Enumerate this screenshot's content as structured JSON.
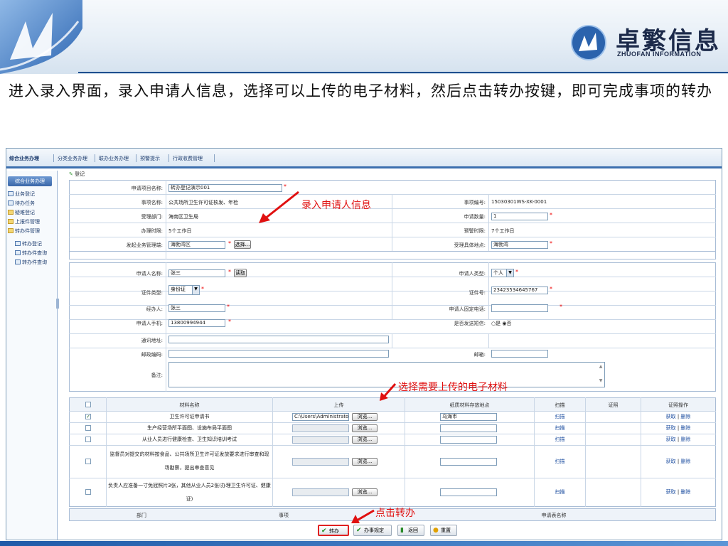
{
  "brand": {
    "name_cn": "卓繁信息",
    "name_en": "ZHUOFAN INFORMATION"
  },
  "instruction": "进入录入界面，录入申请人信息，选择可以上传的电子材料，然后点击转办按键，即可完成事项的转办",
  "app": {
    "nav_tabs": [
      "综合业务办理",
      "分类业务办理",
      "联办业务办理",
      "预警提示",
      "行政收费管理"
    ],
    "sidebar": {
      "title": "综合业务办理",
      "items": [
        "业务登记",
        "待办任务",
        "疑难登记",
        "上报件管理",
        "转办件管理",
        "转办登记",
        "转办件查询",
        "转办件查询"
      ]
    },
    "form_caption": "登记",
    "form": {
      "item_name": {
        "label": "申请项目名称:",
        "value": "转办登记演示001"
      },
      "matter": {
        "label": "事项名称:",
        "value": "公共场所卫生许可证核发、年检"
      },
      "matter_no": {
        "label": "事项编号:",
        "value": "15030301WS-XK-0001"
      },
      "dept": {
        "label": "受理部门:",
        "value": "海南区卫生局"
      },
      "quantity": {
        "label": "申请数量:",
        "value": "1"
      },
      "time_limit": {
        "label": "办理时限:",
        "value": "5个工作日"
      },
      "promise_limit": {
        "label": "预警时限:",
        "value": "7个工作日"
      },
      "origin": {
        "label": "发起业务管理端:",
        "value": "海勃湾区",
        "button": "选择..."
      },
      "location": {
        "label": "受理具体地点:",
        "value": "海勃湾"
      }
    },
    "applicant": {
      "name": {
        "label": "申请人名称:",
        "value": "张三",
        "button": "读取"
      },
      "type": {
        "label": "申请人类型:",
        "value": "个人"
      },
      "id_type": {
        "label": "证件类型:",
        "value": "身份证"
      },
      "id_no": {
        "label": "证件号:",
        "value": "23423534645767"
      },
      "agent": {
        "label": "经办人:",
        "value": "张三"
      },
      "phone": {
        "label": "申请人固定电话:",
        "value": ""
      },
      "mobile": {
        "label": "申请人手机:",
        "value": "13800994944"
      },
      "sms": {
        "label": "是否发送短信:",
        "yes": "是",
        "no": "否"
      },
      "address": {
        "label": "通讯地址:",
        "value": ""
      },
      "postcode": {
        "label": "邮政编码:",
        "value": ""
      },
      "email": {
        "label": "邮箱:",
        "value": ""
      },
      "remark": {
        "label": "备注:",
        "value": ""
      }
    },
    "materials": {
      "headers": [
        "材料名称",
        "上传",
        "纸质材料存放地点",
        "扫描",
        "证照",
        "证照操作"
      ],
      "browse_label": "浏览...",
      "scan_label": "扫描",
      "op_get": "获取",
      "op_delete": "删除",
      "rows": [
        {
          "checked": true,
          "name": "卫生许可证申请书",
          "upload": "C:\\Users\\Administrato",
          "location": "乌海市"
        },
        {
          "checked": false,
          "name": "生产经营场所平面图、设施布局平面图",
          "upload": "",
          "location": ""
        },
        {
          "checked": false,
          "name": "从业人员进行健康检查、卫生知识培训考试",
          "upload": "",
          "location": ""
        },
        {
          "checked": false,
          "name": "监督员对提交的材料按食品、公共场所卫生许可证发放要求进行审查和现场勘察，提出审查意见",
          "upload": "",
          "location": ""
        },
        {
          "checked": false,
          "name": "负责人应准备一寸免冠照片3张，其他从业人员2张(办理卫生许可证、健康证)",
          "upload": "",
          "location": ""
        }
      ]
    },
    "footer_headers": [
      "部门",
      "事项",
      "申请表名称"
    ],
    "action_buttons": [
      "转办",
      "办事规定",
      "返回",
      "重置"
    ]
  },
  "annotations": {
    "applicant_info": "录入申请人信息",
    "upload_materials": "选择需要上传的电子材料",
    "click_transfer": "点击转办"
  },
  "colors": {
    "accent": "#1f4f8f",
    "callout": "#e01010",
    "nav_border": "#3b6fae"
  }
}
